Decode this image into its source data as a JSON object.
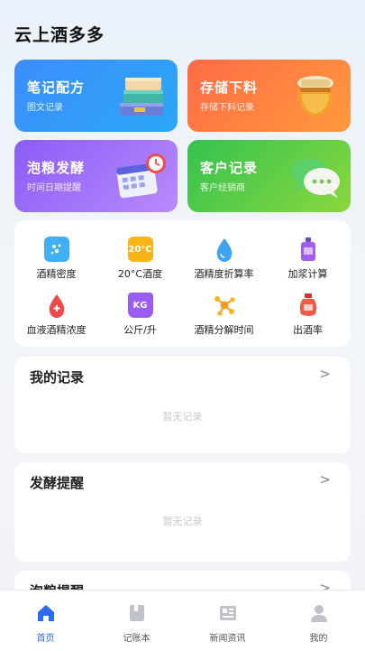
{
  "app": {
    "title": "云上酒多多"
  },
  "cards": [
    {
      "title": "笔记配方",
      "subtitle": "图文记录",
      "icon": "books-icon"
    },
    {
      "title": "存储下料",
      "subtitle": "存储下料记录",
      "icon": "jar-icon"
    },
    {
      "title": "泡粮发酵",
      "subtitle": "时间日期提醒",
      "icon": "calendar-clock-icon"
    },
    {
      "title": "客户记录",
      "subtitle": "客户经销商",
      "icon": "chat-bubble-icon"
    }
  ],
  "tools": [
    {
      "label": "酒精密度",
      "icon": "density-icon",
      "color": "#3fb0f5"
    },
    {
      "label": "20°C酒度",
      "icon": "thermometer-badge-icon",
      "color": "#f7b518",
      "badge": "20°C"
    },
    {
      "label": "酒精度折算率",
      "icon": "water-drop-icon",
      "color": "#3fa3f5"
    },
    {
      "label": "加浆计算",
      "icon": "bottle-icon",
      "color": "#a35df2"
    },
    {
      "label": "血液酒精浓度",
      "icon": "blood-drop-icon",
      "color": "#f04b4b"
    },
    {
      "label": "公斤/升",
      "icon": "weight-icon",
      "color": "#9a5cf2",
      "badge": "KG"
    },
    {
      "label": "酒精分解时间",
      "icon": "molecule-icon",
      "color": "#f59b1f"
    },
    {
      "label": "出酒率",
      "icon": "wine-jar-icon",
      "color": "#f25a45"
    }
  ],
  "panels": [
    {
      "title": "我的记录",
      "empty": "暂无记录"
    },
    {
      "title": "发酵提醒",
      "empty": "暂无记录"
    },
    {
      "title": "泡粮提醒"
    }
  ],
  "tabs": [
    {
      "label": "首页",
      "icon": "home-icon",
      "active": true
    },
    {
      "label": "记账本",
      "icon": "notebook-icon"
    },
    {
      "label": "新闻资讯",
      "icon": "news-icon"
    },
    {
      "label": "我的",
      "icon": "user-icon"
    }
  ],
  "colors": {
    "accent": "#2b6cf6",
    "empty_text": "#c8c8c8"
  }
}
